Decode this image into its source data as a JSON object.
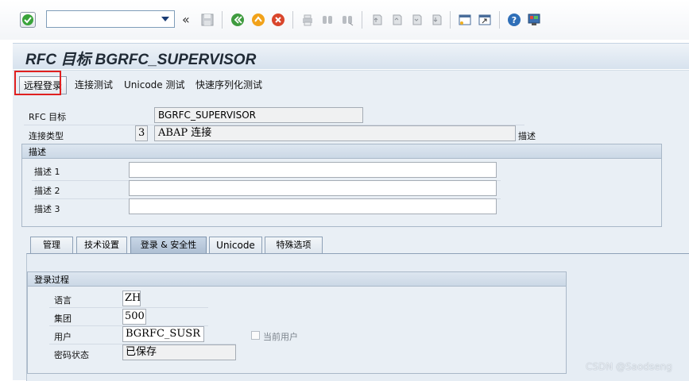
{
  "toolbar": {
    "command_field_value": "",
    "icons": [
      "enter-icon",
      "back-double-arrow-icon",
      "save-icon",
      "back-icon",
      "exit-icon",
      "cancel-icon",
      "print-icon",
      "find-icon",
      "find-next-icon",
      "first-page-icon",
      "previous-page-icon",
      "next-page-icon",
      "last-page-icon",
      "new-session-icon",
      "shortcut-icon",
      "help-icon",
      "layout-icon"
    ]
  },
  "title": "RFC 目标 BGRFC_SUPERVISOR",
  "app_toolbar": {
    "remote_logon": "远程登录",
    "connection_test": "连接测试",
    "unicode_test": "Unicode 测试",
    "serialization_test": "快速序列化测试"
  },
  "header": {
    "rfc_dest_label": "RFC 目标",
    "rfc_dest_value": "BGRFC_SUPERVISOR",
    "conn_type_label": "连接类型",
    "conn_type_code": "3",
    "conn_type_text": "ABAP 连接",
    "desc_suffix": "描述"
  },
  "description_group": {
    "title": "描述",
    "rows": [
      {
        "label": "描述 1",
        "value": ""
      },
      {
        "label": "描述 2",
        "value": ""
      },
      {
        "label": "描述 3",
        "value": ""
      }
    ]
  },
  "tabs": [
    {
      "label": "管理",
      "active": false
    },
    {
      "label": "技术设置",
      "active": false
    },
    {
      "label": "登录 & 安全性",
      "active": true
    },
    {
      "label": "Unicode",
      "active": false
    },
    {
      "label": "特殊选项",
      "active": false
    }
  ],
  "logon_group": {
    "title": "登录过程",
    "language_label": "语言",
    "language_value": "ZH",
    "client_label": "集团",
    "client_value": "500",
    "user_label": "用户",
    "user_value": "BGRFC_SUSR",
    "current_user_label": "当前用户",
    "current_user_checked": false,
    "password_label": "密码状态",
    "password_value": "已保存"
  },
  "watermark": "CSDN @Saodseng"
}
